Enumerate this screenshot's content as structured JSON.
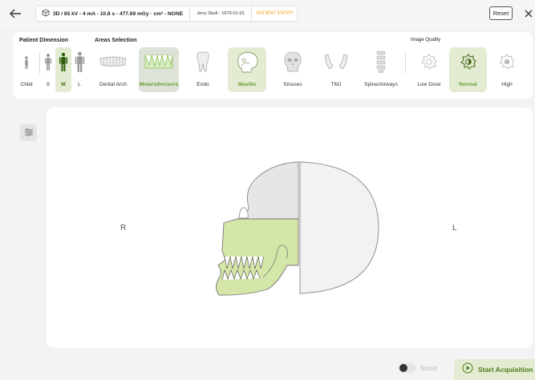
{
  "header": {
    "scan_info": "3D / 85 kV - 4 mA - 10.8 s - 477.69 mGy · cm² - NONE",
    "patient": "Jerry Skull - 1970-01-01",
    "entry": "PATIENT ENTRY",
    "reset_label": "Reset"
  },
  "patient_dimension": {
    "title": "Patient Dimension",
    "options": [
      {
        "label": "Child",
        "selected": false
      },
      {
        "label": "S",
        "selected": false
      },
      {
        "label": "M",
        "selected": true
      },
      {
        "label": "L",
        "selected": false
      }
    ]
  },
  "areas_selection": {
    "title": "Areas Selection",
    "options": [
      {
        "label": "Dental Arch",
        "selected": false
      },
      {
        "label": "Molars/Incisors",
        "selected": true
      },
      {
        "label": "Endo",
        "selected": false
      },
      {
        "label": "Maxillo",
        "selected": true
      },
      {
        "label": "Sinuses",
        "selected": false
      },
      {
        "label": "TMJ",
        "selected": false
      },
      {
        "label": "Spine/Airways",
        "selected": false
      }
    ]
  },
  "image_quality": {
    "title": "Image Quality",
    "options": [
      {
        "label": "Low Dose",
        "selected": false
      },
      {
        "label": "Normal",
        "selected": true
      },
      {
        "label": "High",
        "selected": false
      }
    ]
  },
  "viewer": {
    "left_side": "R",
    "right_side": "L"
  },
  "footer": {
    "scout_label": "Scout",
    "scout_enabled": false,
    "start_label": "Start Acquisition"
  },
  "colors": {
    "accent": "#6a9a30",
    "accent_bg": "#e3ecd3",
    "region_green": "#d4e6a8",
    "region_grey": "#e6e6e6",
    "entry_orange": "#f0a020"
  }
}
